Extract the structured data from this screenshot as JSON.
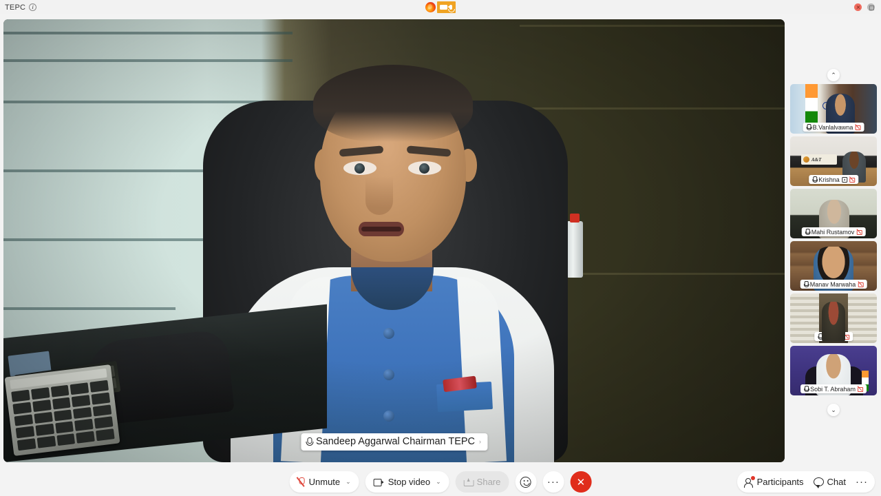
{
  "titlebar": {
    "app_title": "TEPC",
    "info_icon": "info-icon",
    "browser_icon": "firefox-icon",
    "camera_indicator_icon": "camera-icon",
    "mic_indicator_icon": "microphone-icon",
    "window_close": "close-window-button",
    "window_maximize": "maximize-window-button"
  },
  "stage": {
    "active_speaker": {
      "name": "Sandeep Aggarwal Chairman TEPC",
      "mic_state": "unmuted",
      "caret": "›"
    }
  },
  "filmstrip": {
    "scroll_up_icon": "⌃",
    "scroll_down_icon": "⌄",
    "participants": [
      {
        "name": "B.Vanlalvawna",
        "mic": "muted",
        "video": "off",
        "sharing": false
      },
      {
        "name": "Krishna",
        "mic": "muted",
        "video": "off",
        "sharing": true
      },
      {
        "name": "Mahi Rustamov",
        "mic": "muted",
        "video": "off",
        "sharing": false
      },
      {
        "name": "Manav Marwaha",
        "mic": "muted",
        "video": "off",
        "sharing": false
      },
      {
        "name": "Nazim",
        "mic": "muted",
        "video": "off",
        "sharing": false
      },
      {
        "name": "Sobi T. Abraham",
        "mic": "muted",
        "video": "off",
        "sharing": false
      }
    ]
  },
  "toolbar": {
    "unmute_label": "Unmute",
    "unmute_caret": "⌄",
    "stop_video_label": "Stop video",
    "stop_video_caret": "⌄",
    "share_label": "Share",
    "share_disabled": true,
    "reactions_icon": "emoji-reaction-icon",
    "more_icon": "···",
    "end_call_icon": "✕",
    "participants_label": "Participants",
    "participants_badge": true,
    "chat_label": "Chat",
    "right_more_icon": "···"
  },
  "colors": {
    "accent_red": "#e02d1b",
    "notification_red": "#e0362a",
    "indicator_orange": "#f0a323",
    "bar_background": "#f3f3f3"
  }
}
